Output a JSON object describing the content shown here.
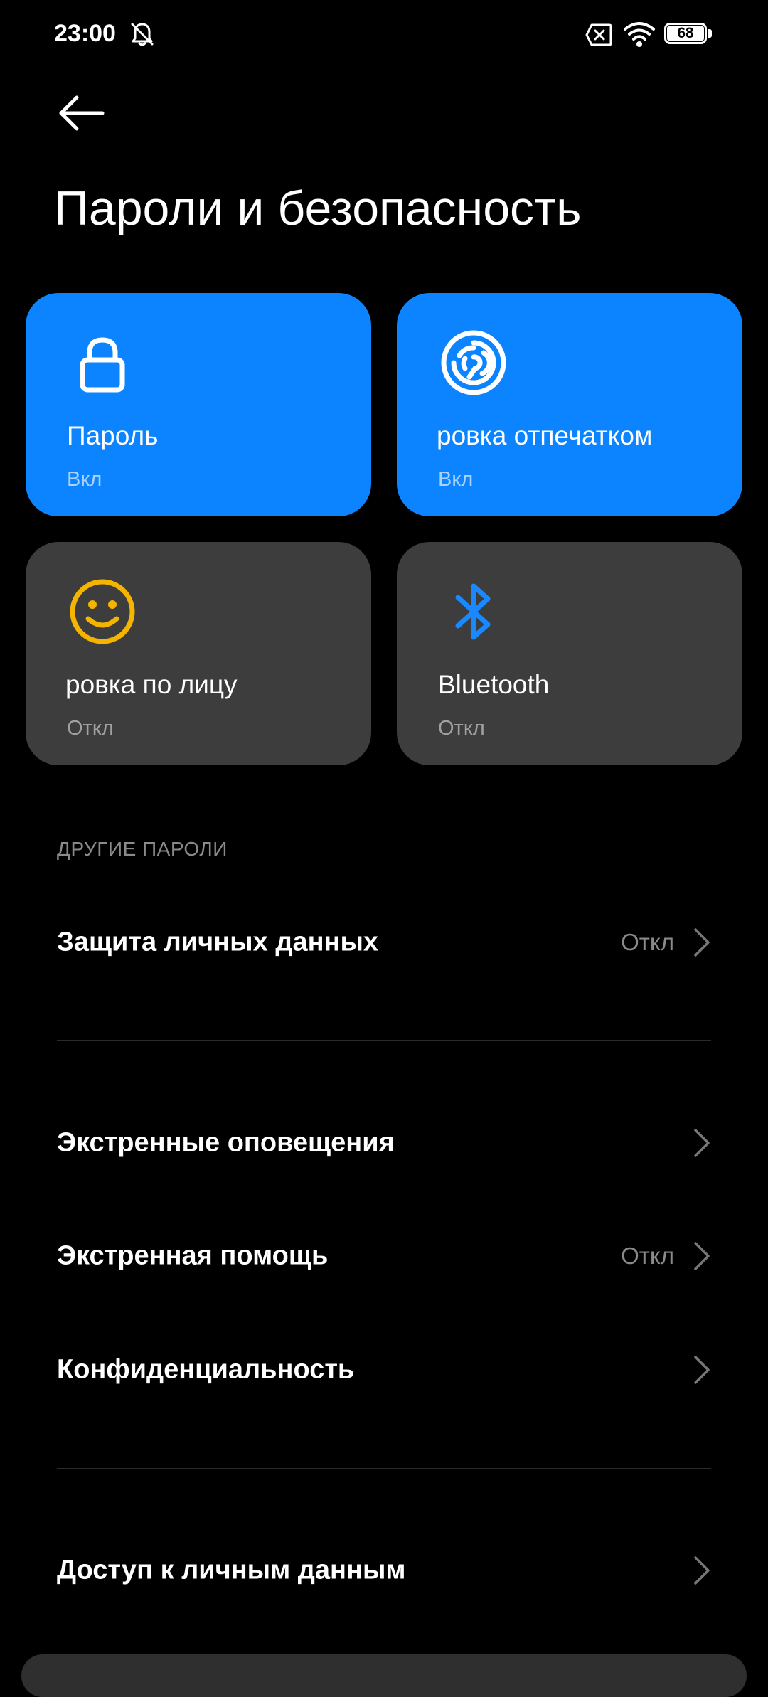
{
  "status_bar": {
    "time": "23:00",
    "battery": "68",
    "icons": [
      "bell-muted-icon",
      "sim-no-signal-icon",
      "wifi-icon",
      "battery-icon"
    ]
  },
  "header": {
    "back_icon": "arrow-left-icon",
    "title": "Пароли и безопасность"
  },
  "tiles": [
    {
      "title": "Разблокировка отпечатком",
      "visible_title": "ровка отпечатком",
      "status": "Вкл",
      "icon": "lock-icon",
      "state": "on"
    },
    {
      "title": "ровка отпечатком",
      "status": "Вкл",
      "icon": "fingerprint-icon",
      "state": "on"
    },
    {
      "title": "ровка по лицу",
      "status": "Откл",
      "icon": "face-smile-icon",
      "state": "off"
    },
    {
      "title": "Bluetooth",
      "status": "Откл",
      "icon": "bluetooth-icon",
      "state": "off"
    }
  ],
  "password_tile": {
    "title": "Пароль",
    "status": "Вкл"
  },
  "section_other": "ДРУГИЕ ПАРОЛИ",
  "list": [
    {
      "label": "Защита личных данных",
      "value": "Откл"
    },
    {
      "label": "Экстренные оповещения",
      "value": ""
    },
    {
      "label": "Экстренная помощь",
      "value": "Откл"
    },
    {
      "label": "Конфиденциальность",
      "value": ""
    },
    {
      "label": "Доступ к личным данным",
      "value": ""
    }
  ],
  "colors": {
    "background": "#000000",
    "tile_on": "#0d84ff",
    "tile_off": "#3d3d3d",
    "face_icon": "#f5b400",
    "bluetooth_icon": "#1a88ff",
    "secondary_text": "#8a8a8a"
  }
}
